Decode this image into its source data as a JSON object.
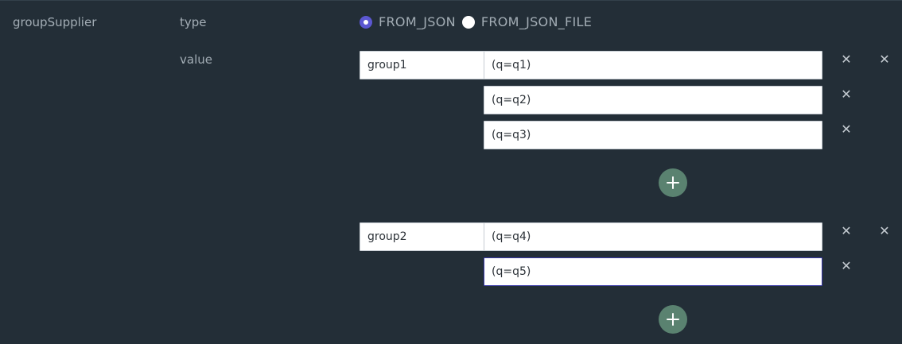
{
  "field": {
    "name": "groupSupplier",
    "type_label": "type",
    "value_label": "value"
  },
  "type_options": [
    {
      "label": "FROM_JSON",
      "selected": true
    },
    {
      "label": "FROM_JSON_FILE",
      "selected": false
    }
  ],
  "groups": [
    {
      "key": "group1",
      "values": [
        "(q=q1)",
        "(q=q2)",
        "(q=q3)"
      ]
    },
    {
      "key": "group2",
      "values": [
        "(q=q4)",
        "(q=q5)"
      ]
    }
  ],
  "icons": {
    "remove": "close-icon",
    "add": "plus-icon"
  },
  "colors": {
    "background": "#232e37",
    "accent_radio": "#5b57d1",
    "add_button": "#5a8270",
    "label_text": "#a3adb5"
  }
}
